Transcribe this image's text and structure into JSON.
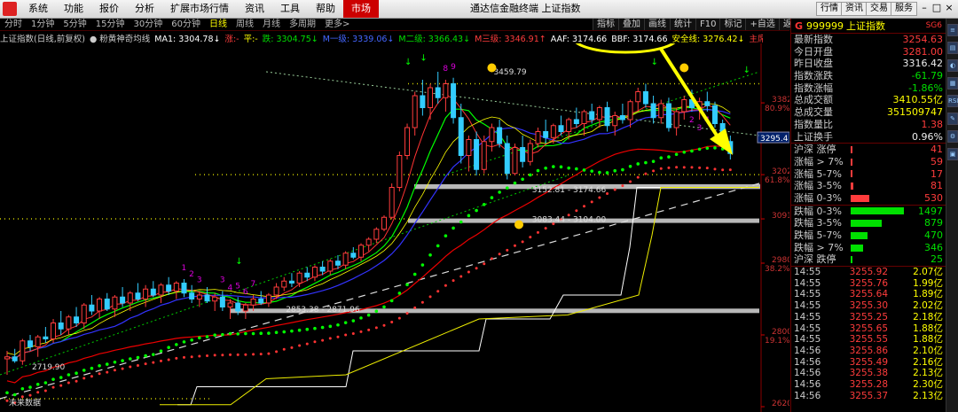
{
  "menu": {
    "items": [
      "系统",
      "功能",
      "报价",
      "分析",
      "扩展市场行情",
      "资讯",
      "工具",
      "帮助"
    ],
    "active": "市场",
    "window_title": "通达信金融终端 上证指数",
    "right_buttons": [
      "行情",
      "资讯",
      "交易",
      "服务"
    ]
  },
  "tabs": [
    "分时",
    "1分钟",
    "5分钟",
    "15分钟",
    "30分钟",
    "60分钟",
    "日线",
    "周线",
    "月线",
    "多周期",
    "更多>"
  ],
  "active_tab": "日线",
  "right_tools": [
    "指标",
    "叠加",
    "画线",
    "统计",
    "F10",
    "标记",
    "+自选",
    "返回"
  ],
  "indicator_line": [
    {
      "text": "上证指数(日线,前复权)",
      "color": "#cccccc"
    },
    {
      "text": "● 粉黄神奇均线",
      "color": "#cccccc"
    },
    {
      "text": "MA1: 3304.78↓",
      "color": "#ffffff"
    },
    {
      "text": "涨:-",
      "color": "#ff3c3c"
    },
    {
      "text": "平:-",
      "color": "#ffff00"
    },
    {
      "text": "跌: 3304.75↓",
      "color": "#00e000"
    },
    {
      "text": "M一级: 3339.06↓",
      "color": "#4466ff"
    },
    {
      "text": "M二级: 3366.43↓",
      "color": "#00e000"
    },
    {
      "text": "M三级: 3346.91↑",
      "color": "#ff3c3c"
    },
    {
      "text": "AAF: 3174.66",
      "color": "#ffffff"
    },
    {
      "text": "BBF: 3174.66",
      "color": "#ffffff"
    },
    {
      "text": "安全线: 3276.42↓",
      "color": "#ffff00"
    },
    {
      "text": "主席操盘线: 3347",
      "color": "#ff3c3c"
    }
  ],
  "chart_data": {
    "type": "candlestick",
    "price_axis": [
      {
        "value": 3382,
        "label": "3382",
        "pct": "80.9%"
      },
      {
        "value": 3295.4,
        "label": "3295.4",
        "pct": ""
      },
      {
        "value": 3202,
        "label": "3202",
        "pct": "61.8%"
      },
      {
        "value": 3091,
        "label": "3091",
        "pct": ""
      },
      {
        "value": 2980,
        "label": "2980",
        "pct": "38.2%"
      },
      {
        "value": 2800,
        "label": "2800",
        "pct": "19.1%"
      },
      {
        "value": 2620,
        "label": "2620",
        "pct": ""
      }
    ],
    "ylim": [
      2620,
      3500
    ],
    "annotations": [
      {
        "text": "3459.79",
        "x": 63,
        "y": 3459.79
      },
      {
        "text": "3374.26 - 336",
        "x": 110,
        "y": 3390
      },
      {
        "text": "3152.81 - 3174.66",
        "x": 68,
        "y": 3165
      },
      {
        "text": "3083.44 - 3104.00",
        "x": 68,
        "y": 3090
      },
      {
        "text": "2853.38 - 2871.96",
        "x": 36,
        "y": 2865
      },
      {
        "text": "2719.90",
        "x": 3,
        "y": 2719.9
      },
      {
        "text": "未来数据",
        "x": 0,
        "y": 2630
      }
    ],
    "bands": [
      {
        "lo": 3166,
        "hi": 3178
      },
      {
        "lo": 3083,
        "hi": 3092
      },
      {
        "lo": 2857,
        "hi": 2866
      }
    ],
    "candles": [
      [
        2740,
        2760,
        2700,
        2745
      ],
      [
        2745,
        2765,
        2730,
        2735
      ],
      [
        2735,
        2790,
        2725,
        2785
      ],
      [
        2785,
        2800,
        2760,
        2770
      ],
      [
        2770,
        2800,
        2745,
        2795
      ],
      [
        2795,
        2820,
        2780,
        2790
      ],
      [
        2790,
        2840,
        2780,
        2830
      ],
      [
        2830,
        2860,
        2800,
        2815
      ],
      [
        2815,
        2850,
        2800,
        2845
      ],
      [
        2845,
        2870,
        2820,
        2830
      ],
      [
        2830,
        2880,
        2815,
        2875
      ],
      [
        2875,
        2900,
        2850,
        2860
      ],
      [
        2860,
        2895,
        2840,
        2890
      ],
      [
        2890,
        2905,
        2860,
        2865
      ],
      [
        2865,
        2900,
        2845,
        2895
      ],
      [
        2895,
        2920,
        2870,
        2880
      ],
      [
        2880,
        2910,
        2860,
        2905
      ],
      [
        2905,
        2930,
        2885,
        2890
      ],
      [
        2890,
        2925,
        2870,
        2915
      ],
      [
        2915,
        2935,
        2895,
        2900
      ],
      [
        2900,
        2930,
        2880,
        2925
      ],
      [
        2925,
        2945,
        2900,
        2910
      ],
      [
        2910,
        2935,
        2890,
        2930
      ],
      [
        2930,
        2940,
        2895,
        2905
      ],
      [
        2905,
        2925,
        2880,
        2890
      ],
      [
        2890,
        2910,
        2870,
        2900
      ],
      [
        2900,
        2920,
        2880,
        2885
      ],
      [
        2885,
        2905,
        2860,
        2895
      ],
      [
        2895,
        2910,
        2860,
        2870
      ],
      [
        2870,
        2890,
        2840,
        2880
      ],
      [
        2880,
        2895,
        2850,
        2860
      ],
      [
        2860,
        2880,
        2840,
        2875
      ],
      [
        2875,
        2900,
        2860,
        2890
      ],
      [
        2890,
        2910,
        2875,
        2880
      ],
      [
        2880,
        2905,
        2870,
        2900
      ],
      [
        2900,
        2930,
        2890,
        2920
      ],
      [
        2920,
        2945,
        2910,
        2935
      ],
      [
        2935,
        2955,
        2920,
        2930
      ],
      [
        2930,
        2960,
        2920,
        2955
      ],
      [
        2955,
        2970,
        2935,
        2945
      ],
      [
        2945,
        2975,
        2935,
        2970
      ],
      [
        2970,
        2985,
        2950,
        2960
      ],
      [
        2960,
        2990,
        2950,
        2985
      ],
      [
        2985,
        3000,
        2965,
        2975
      ],
      [
        2975,
        3010,
        2965,
        3005
      ],
      [
        3005,
        3020,
        2990,
        2995
      ],
      [
        2995,
        3030,
        2985,
        3025
      ],
      [
        3025,
        3045,
        3010,
        3040
      ],
      [
        3040,
        3070,
        3030,
        3065
      ],
      [
        3065,
        3100,
        3060,
        3095
      ],
      [
        3095,
        3180,
        3090,
        3170
      ],
      [
        3170,
        3260,
        3160,
        3250
      ],
      [
        3250,
        3330,
        3240,
        3320
      ],
      [
        3320,
        3410,
        3300,
        3400
      ],
      [
        3400,
        3440,
        3350,
        3370
      ],
      [
        3370,
        3430,
        3340,
        3420
      ],
      [
        3420,
        3460,
        3380,
        3395
      ],
      [
        3395,
        3440,
        3360,
        3430
      ],
      [
        3430,
        3445,
        3330,
        3345
      ],
      [
        3345,
        3380,
        3230,
        3250
      ],
      [
        3250,
        3300,
        3210,
        3290
      ],
      [
        3290,
        3310,
        3200,
        3215
      ],
      [
        3215,
        3300,
        3205,
        3285
      ],
      [
        3285,
        3330,
        3260,
        3320
      ],
      [
        3320,
        3340,
        3270,
        3280
      ],
      [
        3280,
        3300,
        3190,
        3205
      ],
      [
        3205,
        3280,
        3200,
        3270
      ],
      [
        3270,
        3300,
        3220,
        3235
      ],
      [
        3235,
        3290,
        3225,
        3280
      ],
      [
        3280,
        3320,
        3270,
        3310
      ],
      [
        3310,
        3340,
        3280,
        3295
      ],
      [
        3295,
        3330,
        3280,
        3325
      ],
      [
        3325,
        3350,
        3300,
        3310
      ],
      [
        3310,
        3345,
        3290,
        3340
      ],
      [
        3340,
        3370,
        3320,
        3330
      ],
      [
        3330,
        3365,
        3300,
        3360
      ],
      [
        3360,
        3380,
        3330,
        3340
      ],
      [
        3340,
        3375,
        3320,
        3370
      ],
      [
        3370,
        3385,
        3310,
        3325
      ],
      [
        3325,
        3360,
        3300,
        3350
      ],
      [
        3350,
        3380,
        3330,
        3340
      ],
      [
        3340,
        3390,
        3320,
        3385
      ],
      [
        3385,
        3420,
        3360,
        3410
      ],
      [
        3410,
        3430,
        3370,
        3380
      ],
      [
        3380,
        3400,
        3330,
        3345
      ],
      [
        3345,
        3390,
        3330,
        3380
      ],
      [
        3380,
        3395,
        3310,
        3320
      ],
      [
        3320,
        3370,
        3300,
        3360
      ],
      [
        3360,
        3400,
        3340,
        3390
      ],
      [
        3390,
        3415,
        3360,
        3370
      ],
      [
        3370,
        3395,
        3340,
        3385
      ],
      [
        3385,
        3410,
        3360,
        3375
      ],
      [
        3375,
        3385,
        3320,
        3330
      ],
      [
        3330,
        3340,
        3270,
        3285
      ],
      [
        3285,
        3300,
        3240,
        3255
      ]
    ],
    "labels": {
      "purple_numbers": [
        {
          "t": "1",
          "x": 23
        },
        {
          "t": "2",
          "x": 24
        },
        {
          "t": "3",
          "x": 25
        },
        {
          "t": "3",
          "x": 28
        },
        {
          "t": "4",
          "x": 29
        },
        {
          "t": "5",
          "x": 30
        },
        {
          "t": "6",
          "x": 31
        },
        {
          "t": "7",
          "x": 32
        },
        {
          "t": "8",
          "x": 57
        },
        {
          "t": "9",
          "x": 58
        },
        {
          "t": "2",
          "x": 89
        },
        {
          "t": "3",
          "x": 90
        },
        {
          "t": "4",
          "x": 91
        }
      ]
    },
    "callout": "安全线: 3276.42↓",
    "last_price_tag": "3295.4"
  },
  "quote": {
    "g_label": "G",
    "code": "999999",
    "name": "上证指数",
    "sg": "SG6",
    "fields": [
      {
        "k": "最新指数",
        "v": "3254.63",
        "c": "red"
      },
      {
        "k": "今日开盘",
        "v": "3281.00",
        "c": "red"
      },
      {
        "k": "昨日收盘",
        "v": "3316.42",
        "c": "white"
      },
      {
        "k": "指数涨跌",
        "v": "-61.79",
        "c": "green"
      },
      {
        "k": "指数涨幅",
        "v": "-1.86%",
        "c": "green"
      },
      {
        "k": "总成交额",
        "v": "3410.55亿",
        "c": "yellow"
      },
      {
        "k": "总成交量",
        "v": "351509747",
        "c": "yellow"
      },
      {
        "k": "指数量比",
        "v": "1.38",
        "c": "red"
      },
      {
        "k": "上证换手",
        "v": "0.96%",
        "c": "white"
      }
    ],
    "breadth_up": [
      {
        "k": "沪深 涨停",
        "v": "41",
        "frac": 0.028
      },
      {
        "k": "涨幅 > 7%",
        "v": "59",
        "frac": 0.039
      },
      {
        "k": "涨幅 5-7%",
        "v": "17",
        "frac": 0.011
      },
      {
        "k": "涨幅 3-5%",
        "v": "81",
        "frac": 0.054
      },
      {
        "k": "涨幅 0-3%",
        "v": "530",
        "frac": 0.354
      }
    ],
    "breadth_down": [
      {
        "k": "跌幅 0-3%",
        "v": "1497",
        "frac": 1.0
      },
      {
        "k": "跌幅 3-5%",
        "v": "879",
        "frac": 0.587
      },
      {
        "k": "跌幅 5-7%",
        "v": "470",
        "frac": 0.314
      },
      {
        "k": "跌幅 > 7%",
        "v": "346",
        "frac": 0.231
      },
      {
        "k": "沪深 跌停",
        "v": "25",
        "frac": 0.017
      }
    ],
    "ticks": [
      {
        "t": "14:55",
        "p": "3255.92",
        "v": "2.07亿"
      },
      {
        "t": "14:55",
        "p": "3255.76",
        "v": "1.99亿"
      },
      {
        "t": "14:55",
        "p": "3255.64",
        "v": "1.89亿"
      },
      {
        "t": "14:55",
        "p": "3255.30",
        "v": "2.02亿"
      },
      {
        "t": "14:55",
        "p": "3255.25",
        "v": "2.18亿"
      },
      {
        "t": "14:55",
        "p": "3255.65",
        "v": "1.88亿"
      },
      {
        "t": "14:55",
        "p": "3255.55",
        "v": "1.88亿"
      },
      {
        "t": "14:56",
        "p": "3255.86",
        "v": "2.10亿"
      },
      {
        "t": "14:56",
        "p": "3255.49",
        "v": "2.16亿"
      },
      {
        "t": "14:56",
        "p": "3255.38",
        "v": "2.13亿"
      },
      {
        "t": "14:56",
        "p": "3255.28",
        "v": "2.30亿"
      },
      {
        "t": "14:56",
        "p": "3255.37",
        "v": "2.13亿"
      }
    ]
  },
  "side_icons": [
    "≡",
    "▤",
    "◐",
    "▦",
    "RSI",
    "✎",
    "⚙",
    "▣"
  ]
}
